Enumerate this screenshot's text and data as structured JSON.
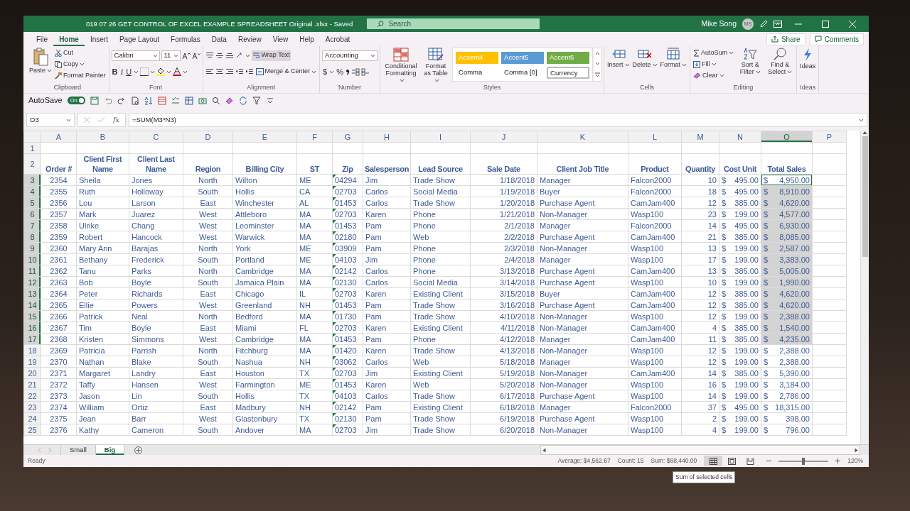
{
  "window": {
    "title": "019 07 26 GET CONTROL OF EXCEL EXAMPLE SPREADSHEET Original .xlsx  -  Saved",
    "search_placeholder": "Search",
    "user": "Mike Song",
    "avatar_initials": "MS"
  },
  "menu_tabs": [
    {
      "label": "File",
      "selected": false
    },
    {
      "label": "Home",
      "selected": true
    },
    {
      "label": "Insert",
      "selected": false
    },
    {
      "label": "Page Layout",
      "selected": false
    },
    {
      "label": "Formulas",
      "selected": false
    },
    {
      "label": "Data",
      "selected": false
    },
    {
      "label": "Review",
      "selected": false
    },
    {
      "label": "View",
      "selected": false
    },
    {
      "label": "Help",
      "selected": false
    },
    {
      "label": "Acrobat",
      "selected": false
    }
  ],
  "share": "Share",
  "comments": "Comments",
  "ribbon": {
    "clipboard": {
      "label": "Clipboard",
      "paste": "Paste",
      "cut": "Cut",
      "copy": "Copy",
      "format_painter": "Format Painter"
    },
    "font": {
      "label": "Font",
      "font_name": "Calibri",
      "font_size": "11",
      "bold": "B",
      "italic": "I",
      "underline": "U"
    },
    "alignment": {
      "label": "Alignment",
      "wrap_text": {
        "label": "Wrap Text",
        "on": true
      },
      "merge_center": "Merge & Center"
    },
    "number": {
      "label": "Number",
      "format": "Accounting",
      "currency": "$",
      "percent": "%"
    },
    "styles": {
      "label": "Styles",
      "conditional_formatting": "Conditional Formatting",
      "format_as_table": "Format as Table",
      "cell_styles": [
        {
          "label": "Accent4",
          "color": "#ffc000",
          "selected": false
        },
        {
          "label": "Accent5",
          "color": "#5b9bd5",
          "selected": false
        },
        {
          "label": "Accent6",
          "color": "#70ad47",
          "selected": false
        },
        {
          "label": "Comma",
          "selected": false
        },
        {
          "label": "Comma [0]",
          "selected": false
        },
        {
          "label": "Currency",
          "selected": true
        }
      ]
    },
    "cells": {
      "label": "Cells",
      "insert": "Insert",
      "delete": "Delete",
      "format": "Format"
    },
    "editing": {
      "label": "Editing",
      "autosum": "AutoSum",
      "fill": "Fill",
      "clear": "Clear",
      "sort_filter": "Sort & Filter",
      "find_select": "Find & Select"
    },
    "ideas": {
      "label": "Ideas",
      "ideas": "Ideas"
    }
  },
  "quick_access": {
    "autosave_label": "AutoSave",
    "autosave": {
      "label": "On",
      "on": true
    }
  },
  "formula_bar": {
    "name_box": "O3",
    "function_label": "fx",
    "formula": "=SUM(M3*N3)"
  },
  "sheet": {
    "columns": [
      {
        "letter": "A",
        "selected": false
      },
      {
        "letter": "B",
        "selected": false
      },
      {
        "letter": "C",
        "selected": false
      },
      {
        "letter": "D",
        "selected": false
      },
      {
        "letter": "E",
        "selected": false
      },
      {
        "letter": "F",
        "selected": false
      },
      {
        "letter": "G",
        "selected": false
      },
      {
        "letter": "H",
        "selected": false
      },
      {
        "letter": "I",
        "selected": false
      },
      {
        "letter": "J",
        "selected": false
      },
      {
        "letter": "K",
        "selected": false
      },
      {
        "letter": "L",
        "selected": false
      },
      {
        "letter": "M",
        "selected": false
      },
      {
        "letter": "N",
        "selected": false
      },
      {
        "letter": "O",
        "selected": true
      },
      {
        "letter": "P",
        "selected": false
      }
    ],
    "blank_row": {
      "number": "1"
    },
    "header_row": {
      "number": "2",
      "cells": [
        "Order #",
        "Client First Name",
        "Client Last Name",
        "Region",
        "Billing City",
        "ST",
        "Zip",
        "Salesperson",
        "Lead Source",
        "Sale Date",
        "Client Job Title",
        "Product",
        "Quantity",
        "Cost Unit",
        "Total Sales"
      ]
    },
    "rows": [
      {
        "number": "3",
        "selected": true,
        "cells": [
          "2354",
          "Sheila",
          "Jones",
          "North",
          "Wilton",
          "ME",
          "04294",
          "Jim",
          "Trade Show",
          "1/18/2018",
          "Manager",
          "Falcon2000",
          "10"
        ],
        "cost_unit": {
          "symbol": "$",
          "amount": "495.00"
        },
        "total_sales": {
          "symbol": "$",
          "amount": "4,950.00",
          "active": true
        }
      },
      {
        "number": "4",
        "selected": true,
        "cells": [
          "2355",
          "Ruth",
          "Holloway",
          "South",
          "Hollis",
          "CA",
          "02703",
          "Carlos",
          "Social Media",
          "1/19/2018",
          "Buyer",
          "Falcon2000",
          "18"
        ],
        "cost_unit": {
          "symbol": "$",
          "amount": "495.00"
        },
        "total_sales": {
          "symbol": "$",
          "amount": "8,910.00",
          "active": false
        }
      },
      {
        "number": "5",
        "selected": true,
        "cells": [
          "2356",
          "Lou",
          "Larson",
          "East",
          "Winchester",
          "AL",
          "01453",
          "Carlos",
          "Trade Show",
          "1/20/2018",
          "Purchase Agent",
          "CamJam400",
          "12"
        ],
        "cost_unit": {
          "symbol": "$",
          "amount": "385.00"
        },
        "total_sales": {
          "symbol": "$",
          "amount": "4,620.00",
          "active": false
        }
      },
      {
        "number": "6",
        "selected": true,
        "cells": [
          "2357",
          "Mark",
          "Juarez",
          "West",
          "Attleboro",
          "MA",
          "02703",
          "Karen",
          "Phone",
          "1/21/2018",
          "Non-Manager",
          "Wasp100",
          "23"
        ],
        "cost_unit": {
          "symbol": "$",
          "amount": "199.00"
        },
        "total_sales": {
          "symbol": "$",
          "amount": "4,577.00",
          "active": false
        }
      },
      {
        "number": "7",
        "selected": true,
        "cells": [
          "2358",
          "Ulrike",
          "Chang",
          "West",
          "Leominster",
          "MA",
          "01453",
          "Pam",
          "Phone",
          "2/1/2018",
          "Manager",
          "Falcon2000",
          "14"
        ],
        "cost_unit": {
          "symbol": "$",
          "amount": "495.00"
        },
        "total_sales": {
          "symbol": "$",
          "amount": "6,930.00",
          "active": false
        }
      },
      {
        "number": "8",
        "selected": true,
        "cells": [
          "2359",
          "Robert",
          "Hancock",
          "West",
          "Warwick",
          "MA",
          "02180",
          "Pam",
          "Web",
          "2/2/2018",
          "Purchase Agent",
          "CamJam400",
          "21"
        ],
        "cost_unit": {
          "symbol": "$",
          "amount": "385.00"
        },
        "total_sales": {
          "symbol": "$",
          "amount": "8,085.00",
          "active": false
        }
      },
      {
        "number": "9",
        "selected": true,
        "cells": [
          "2360",
          "Mary Ann",
          "Barajas",
          "North",
          "York",
          "ME",
          "03909",
          "Pam",
          "Phone",
          "2/3/2018",
          "Non-Manager",
          "Wasp100",
          "13"
        ],
        "cost_unit": {
          "symbol": "$",
          "amount": "199.00"
        },
        "total_sales": {
          "symbol": "$",
          "amount": "2,587.00",
          "active": false
        }
      },
      {
        "number": "10",
        "selected": true,
        "cells": [
          "2361",
          "Bethany",
          "Frederick",
          "South",
          "Portland",
          "ME",
          "04103",
          "Jim",
          "Phone",
          "2/4/2018",
          "Manager",
          "Wasp100",
          "17"
        ],
        "cost_unit": {
          "symbol": "$",
          "amount": "199.00"
        },
        "total_sales": {
          "symbol": "$",
          "amount": "3,383.00",
          "active": false
        }
      },
      {
        "number": "11",
        "selected": true,
        "cells": [
          "2362",
          "Tanu",
          "Parks",
          "North",
          "Cambridge",
          "MA",
          "02142",
          "Carlos",
          "Phone",
          "3/13/2018",
          "Purchase Agent",
          "CamJam400",
          "13"
        ],
        "cost_unit": {
          "symbol": "$",
          "amount": "385.00"
        },
        "total_sales": {
          "symbol": "$",
          "amount": "5,005.00",
          "active": false
        }
      },
      {
        "number": "12",
        "selected": true,
        "cells": [
          "2363",
          "Bob",
          "Boyle",
          "South",
          "Jamaica Plain",
          "MA",
          "02130",
          "Carlos",
          "Social Media",
          "3/14/2018",
          "Purchase Agent",
          "Wasp100",
          "10"
        ],
        "cost_unit": {
          "symbol": "$",
          "amount": "199.00"
        },
        "total_sales": {
          "symbol": "$",
          "amount": "1,990.00",
          "active": false
        }
      },
      {
        "number": "13",
        "selected": true,
        "cells": [
          "2364",
          "Peter",
          "Richards",
          "East",
          "Chicago",
          "IL",
          "02703",
          "Karen",
          "Existing Client",
          "3/15/2018",
          "Buyer",
          "CamJam400",
          "12"
        ],
        "cost_unit": {
          "symbol": "$",
          "amount": "385.00"
        },
        "total_sales": {
          "symbol": "$",
          "amount": "4,620.00",
          "active": false
        }
      },
      {
        "number": "14",
        "selected": true,
        "cells": [
          "2365",
          "Ellie",
          "Powers",
          "West",
          "Greenland",
          "NH",
          "01453",
          "Pam",
          "Trade Show",
          "3/16/2018",
          "Purchase Agent",
          "CamJam400",
          "12"
        ],
        "cost_unit": {
          "symbol": "$",
          "amount": "385.00"
        },
        "total_sales": {
          "symbol": "$",
          "amount": "4,620.00",
          "active": false
        }
      },
      {
        "number": "15",
        "selected": true,
        "cells": [
          "2366",
          "Patrick",
          "Neal",
          "North",
          "Bedford",
          "MA",
          "01730",
          "Pam",
          "Trade Show",
          "4/10/2018",
          "Non-Manager",
          "Wasp100",
          "12"
        ],
        "cost_unit": {
          "symbol": "$",
          "amount": "199.00"
        },
        "total_sales": {
          "symbol": "$",
          "amount": "2,388.00",
          "active": false
        }
      },
      {
        "number": "16",
        "selected": true,
        "cells": [
          "2367",
          "Tim",
          "Boyle",
          "East",
          "Miami",
          "FL",
          "02703",
          "Karen",
          "Existing Client",
          "4/11/2018",
          "Non-Manager",
          "CamJam400",
          "4"
        ],
        "cost_unit": {
          "symbol": "$",
          "amount": "385.00"
        },
        "total_sales": {
          "symbol": "$",
          "amount": "1,540.00",
          "active": false
        }
      },
      {
        "number": "17",
        "selected": true,
        "cells": [
          "2368",
          "Kristen",
          "Simmons",
          "West",
          "Cambridge",
          "MA",
          "01453",
          "Pam",
          "Phone",
          "4/12/2018",
          "Manager",
          "CamJam400",
          "11"
        ],
        "cost_unit": {
          "symbol": "$",
          "amount": "385.00"
        },
        "total_sales": {
          "symbol": "$",
          "amount": "4,235.00",
          "active": false
        }
      },
      {
        "number": "18",
        "selected": false,
        "cells": [
          "2369",
          "Patricia",
          "Parrish",
          "North",
          "Fitchburg",
          "MA",
          "01420",
          "Karen",
          "Trade Show",
          "4/13/2018",
          "Non-Manager",
          "Wasp100",
          "12"
        ],
        "cost_unit": {
          "symbol": "$",
          "amount": "199.00"
        },
        "total_sales": {
          "symbol": "$",
          "amount": "2,388.00",
          "active": false
        }
      },
      {
        "number": "19",
        "selected": false,
        "cells": [
          "2370",
          "Nathan",
          "Blake",
          "South",
          "Nashua",
          "NH",
          "03062",
          "Carlos",
          "Web",
          "5/18/2018",
          "Manager",
          "Wasp100",
          "12"
        ],
        "cost_unit": {
          "symbol": "$",
          "amount": "199.00"
        },
        "total_sales": {
          "symbol": "$",
          "amount": "2,388.00",
          "active": false
        }
      },
      {
        "number": "20",
        "selected": false,
        "cells": [
          "2371",
          "Margaret",
          "Landry",
          "East",
          "Houston",
          "TX",
          "02703",
          "Jim",
          "Existing Client",
          "5/19/2018",
          "Non-Manager",
          "CamJam400",
          "14"
        ],
        "cost_unit": {
          "symbol": "$",
          "amount": "385.00"
        },
        "total_sales": {
          "symbol": "$",
          "amount": "5,390.00",
          "active": false
        }
      },
      {
        "number": "21",
        "selected": false,
        "cells": [
          "2372",
          "Taffy",
          "Hansen",
          "West",
          "Farmington",
          "ME",
          "01453",
          "Karen",
          "Web",
          "5/20/2018",
          "Non-Manager",
          "Wasp100",
          "16"
        ],
        "cost_unit": {
          "symbol": "$",
          "amount": "199.00"
        },
        "total_sales": {
          "symbol": "$",
          "amount": "3,184.00",
          "active": false
        }
      },
      {
        "number": "22",
        "selected": false,
        "cells": [
          "2373",
          "Jason",
          "Lin",
          "South",
          "Hollis",
          "TX",
          "04103",
          "Carlos",
          "Trade Show",
          "6/17/2018",
          "Purchase Agent",
          "Wasp100",
          "14"
        ],
        "cost_unit": {
          "symbol": "$",
          "amount": "199.00"
        },
        "total_sales": {
          "symbol": "$",
          "amount": "2,786.00",
          "active": false
        }
      },
      {
        "number": "23",
        "selected": false,
        "cells": [
          "2374",
          "William",
          "Ortiz",
          "East",
          "Madbury",
          "NH",
          "02142",
          "Pam",
          "Existing Client",
          "6/18/2018",
          "Manager",
          "Falcon2000",
          "37"
        ],
        "cost_unit": {
          "symbol": "$",
          "amount": "495.00"
        },
        "total_sales": {
          "symbol": "$",
          "amount": "18,315.00",
          "active": false
        }
      },
      {
        "number": "24",
        "selected": false,
        "cells": [
          "2375",
          "Jean",
          "Barr",
          "West",
          "Glastonbury",
          "TX",
          "02130",
          "Pam",
          "Trade Show",
          "6/19/2018",
          "Purchase Agent",
          "Wasp100",
          "2"
        ],
        "cost_unit": {
          "symbol": "$",
          "amount": "199.00"
        },
        "total_sales": {
          "symbol": "$",
          "amount": "398.00",
          "active": false
        }
      },
      {
        "number": "25",
        "selected": false,
        "cells": [
          "2376",
          "Kathy",
          "Cameron",
          "South",
          "Andover",
          "MA",
          "02703",
          "Jim",
          "Trade Show",
          "6/20/2018",
          "Non-Manager",
          "Wasp100",
          "4"
        ],
        "cost_unit": {
          "symbol": "$",
          "amount": "199.00"
        },
        "total_sales": {
          "symbol": "$",
          "amount": "796.00",
          "active": false
        }
      }
    ]
  },
  "sheet_tabs": [
    {
      "label": "Small",
      "selected": false
    },
    {
      "label": "Big",
      "selected": true
    }
  ],
  "status_bar": {
    "mode": "Ready",
    "average": "Average: $4,562.67",
    "count": "Count: 15",
    "sum": "Sum: $68,440.00",
    "views": [
      {
        "selected": true
      },
      {
        "selected": false
      },
      {
        "selected": false
      }
    ],
    "zoom_slider": {
      "level": 0.5
    },
    "zoom": "120%"
  },
  "tooltip": "Sum of selected cells"
}
